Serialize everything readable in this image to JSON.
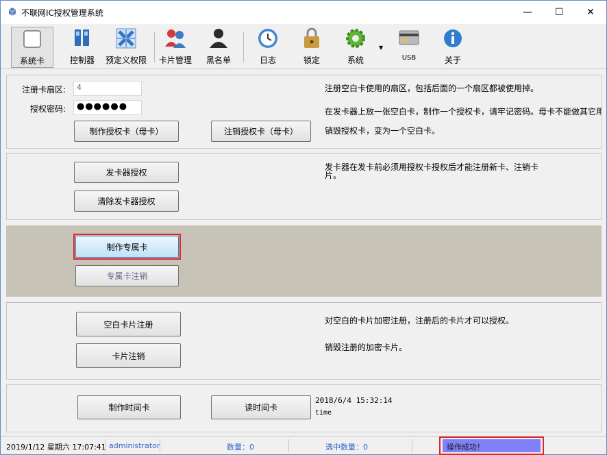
{
  "window": {
    "title": "不联网IC授权管理系统"
  },
  "titlebar": {
    "minimize": "—",
    "maximize": "☐",
    "close": "✕"
  },
  "toolbar": {
    "items": [
      {
        "label": "系统卡",
        "icon": "card-blank-icon"
      },
      {
        "label": "控制器",
        "icon": "controller-icon"
      },
      {
        "label": "预定义权限",
        "icon": "permission-icon"
      },
      {
        "label": "卡片管理",
        "icon": "users-icon"
      },
      {
        "label": "黑名单",
        "icon": "blacklist-user-icon"
      },
      {
        "label": "日志",
        "icon": "clock-icon"
      },
      {
        "label": "锁定",
        "icon": "lock-icon"
      },
      {
        "label": "系统",
        "icon": "gear-icon"
      },
      {
        "label": "USB",
        "icon": "usb-card-icon"
      },
      {
        "label": "关于",
        "icon": "info-icon"
      }
    ]
  },
  "section1": {
    "sector_label": "注册卡扇区:",
    "sector_value": "4",
    "password_label": "授权密码:",
    "password_value": "●●●●●●",
    "btn_make_auth": "制作授权卡（母卡）",
    "btn_cancel_auth": "注销授权卡（母卡）",
    "desc1": "注册空白卡使用的扇区，包括后面的一个扇区都被使用掉。",
    "desc2": "在发卡器上放一张空白卡，制作一个授权卡，请牢记密码。母卡不能做其它用",
    "desc3": "销毁授权卡，变为一个空白卡。"
  },
  "section2": {
    "btn_auth_issuer": "发卡器授权",
    "btn_clear_issuer": "清除发卡器授权",
    "desc_line1": "发卡器在发卡前必须用授权卡授权后才能注册新卡、注销卡",
    "desc_line2": "片。"
  },
  "section3": {
    "btn_make_exclusive": "制作专属卡",
    "btn_cancel_exclusive": "专属卡注销"
  },
  "section4": {
    "btn_register_blank": "空白卡片注册",
    "btn_card_cancel": "卡片注销",
    "desc1": "对空白的卡片加密注册，注册后的卡片才可以授权。",
    "desc2": "销毁注册的加密卡片。"
  },
  "section5": {
    "btn_make_time": "制作时间卡",
    "btn_read_time": "读时间卡",
    "time_value": "2018/6/4 15:32:14",
    "time_label": "time"
  },
  "statusbar": {
    "datetime": "2019/1/12 星期六 17:07:41",
    "user": "administrator",
    "count": "数量：0",
    "selected": "选中数量：0",
    "message": "操作成功！"
  }
}
